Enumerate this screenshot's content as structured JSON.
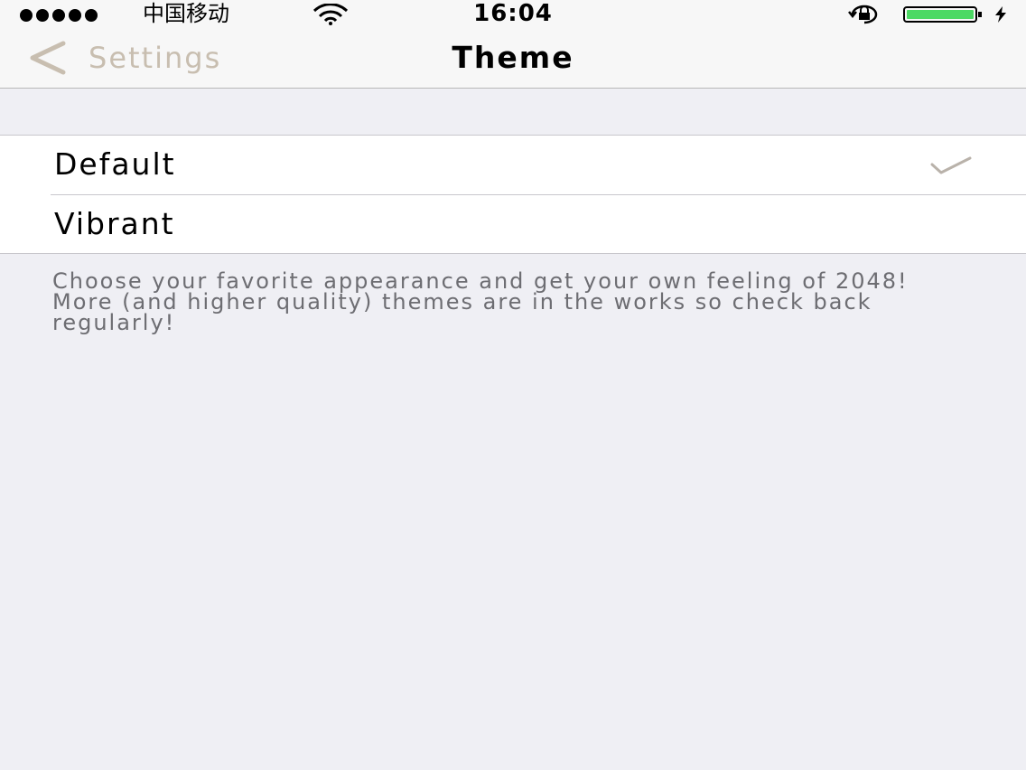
{
  "status_bar": {
    "carrier": "中国移动",
    "time": "16:04",
    "battery_level": 1.0,
    "battery_color": "#4cd964",
    "icons": [
      "signal-dots-icon",
      "wifi-icon",
      "rotation-lock-icon",
      "battery-icon",
      "charging-bolt-icon"
    ]
  },
  "nav": {
    "back_label": "Settings",
    "title": "Theme",
    "accent_color": "#c8beb0"
  },
  "theme_options": [
    {
      "label": "Default",
      "selected": true
    },
    {
      "label": "Vibrant",
      "selected": false
    }
  ],
  "footer_note": "Choose your favorite appearance and get your own feeling of 2048! More (and higher quality) themes are in the works so check back regularly!"
}
